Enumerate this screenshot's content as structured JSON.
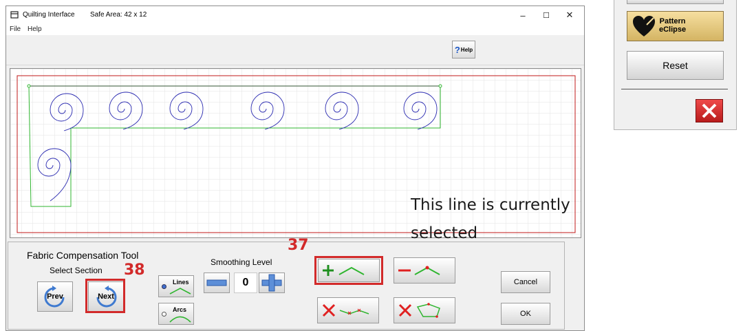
{
  "window": {
    "title": "Quilting Interface",
    "safe_area": "Safe Area:  42 x 12",
    "minimize": "–",
    "maximize": "☐",
    "close": "✕"
  },
  "menu": {
    "file": "File",
    "help": "Help"
  },
  "toolbar": {
    "help_label": "Help",
    "help_q": "?"
  },
  "canvas": {
    "annotation": "This line is currently selected"
  },
  "panel": {
    "title": "Fabric Compensation Tool",
    "select_section": "Select Section",
    "prev": "Prev",
    "next": "Next",
    "lines": "Lines",
    "arcs": "Arcs",
    "smoothing_label": "Smoothing Level",
    "smoothing_value": "0",
    "cancel": "Cancel",
    "ok": "OK",
    "callout_37": "37",
    "callout_38": "38"
  },
  "side_panel": {
    "pattern_line1": "Pattern",
    "pattern_line2": "eClipse",
    "reset": "Reset"
  },
  "colors": {
    "highlight_red": "#d22a2a",
    "pattern_gold": "#d4b463",
    "curve_blue": "#2a2ab0",
    "outline_green": "#2fb52f",
    "canvas_border": "#c01818"
  }
}
